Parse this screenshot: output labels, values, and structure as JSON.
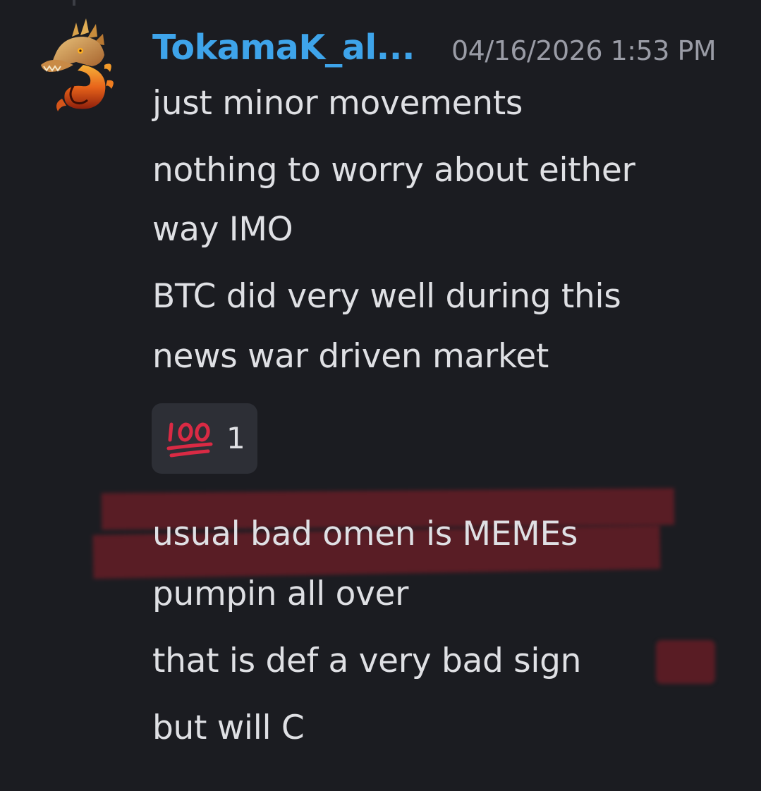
{
  "message": {
    "author": "TokamaK_al...",
    "timestamp": "04/16/2026 1:53 PM",
    "lines_group1": [
      "just minor movements",
      "nothing to worry about either",
      "way IMO",
      "BTC did very well during this",
      "news war driven market"
    ],
    "reaction": {
      "emoji_name": "hundred-points-icon",
      "count": "1"
    },
    "lines_group2": [
      "usual bad omen is MEMEs",
      "pumpin all over",
      "that is def a very bad sign",
      "but will C"
    ]
  },
  "colors": {
    "background": "#1b1c21",
    "username": "#3ea4ea",
    "timestamp": "#9a9ca6",
    "text": "#dfe0e4",
    "reaction_bg": "#2d2f36",
    "highlight": "#8c1e28"
  }
}
